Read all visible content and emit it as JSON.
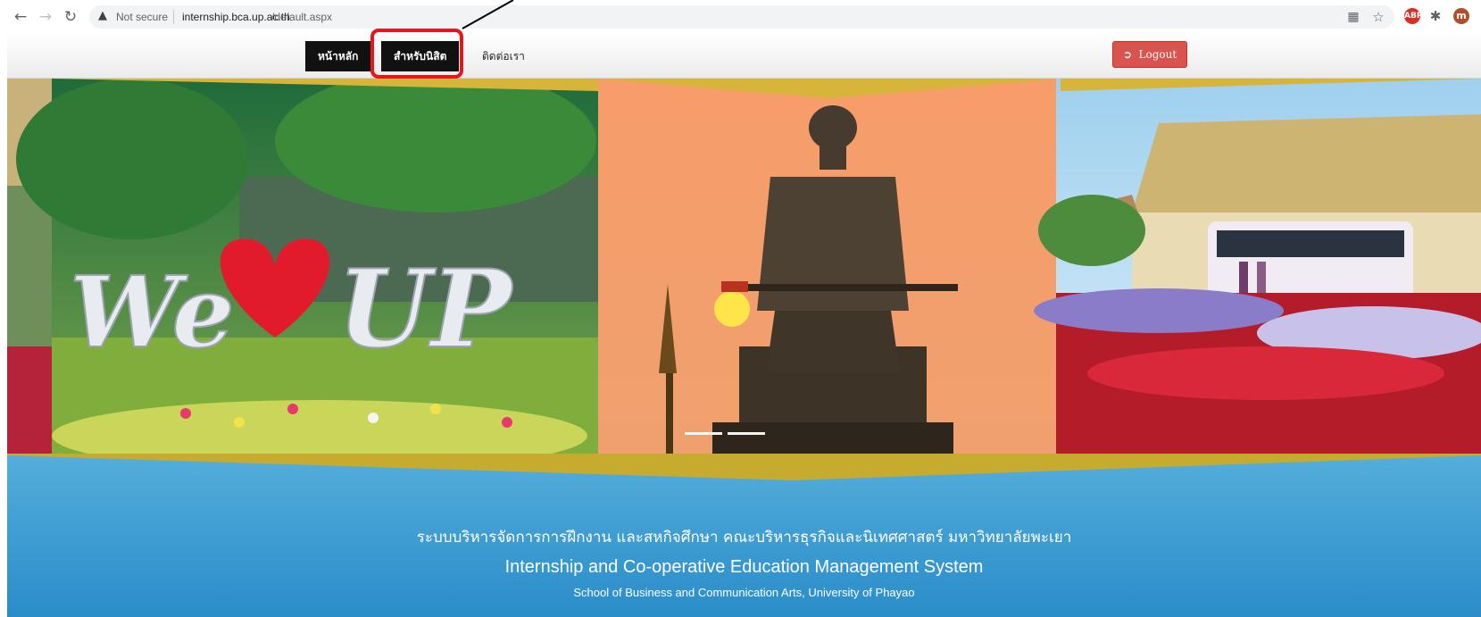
{
  "browser": {
    "security_label": "Not secure",
    "url_host": "internship.bca.up.ac.th",
    "url_path": "/default.aspx",
    "extensions": [
      "ABP",
      "m"
    ]
  },
  "menu": {
    "home": "หน้าหลัก",
    "students": "สำหรับนิสิต",
    "contact": "ติดต่อเรา",
    "logout": "Logout"
  },
  "carousel": {
    "slide1_sign": "We UP"
  },
  "footer": {
    "thai_title": "ระบบบริหารจัดการการฝึกงาน และสหกิจศึกษา คณะบริหารธุรกิจและนิเทศศาสตร์ มหาวิทยาลัยพะเยา",
    "english_title": "Internship and Co-operative Education Management System",
    "subtitle": "School of Business and Communication Arts, University of Phayao"
  },
  "colors": {
    "logout_bg": "#d9534f",
    "menu_active_bg": "#111111",
    "highlight": "#e8151b",
    "footer_top": "#55aedb",
    "footer_bottom": "#2a8cc9"
  }
}
